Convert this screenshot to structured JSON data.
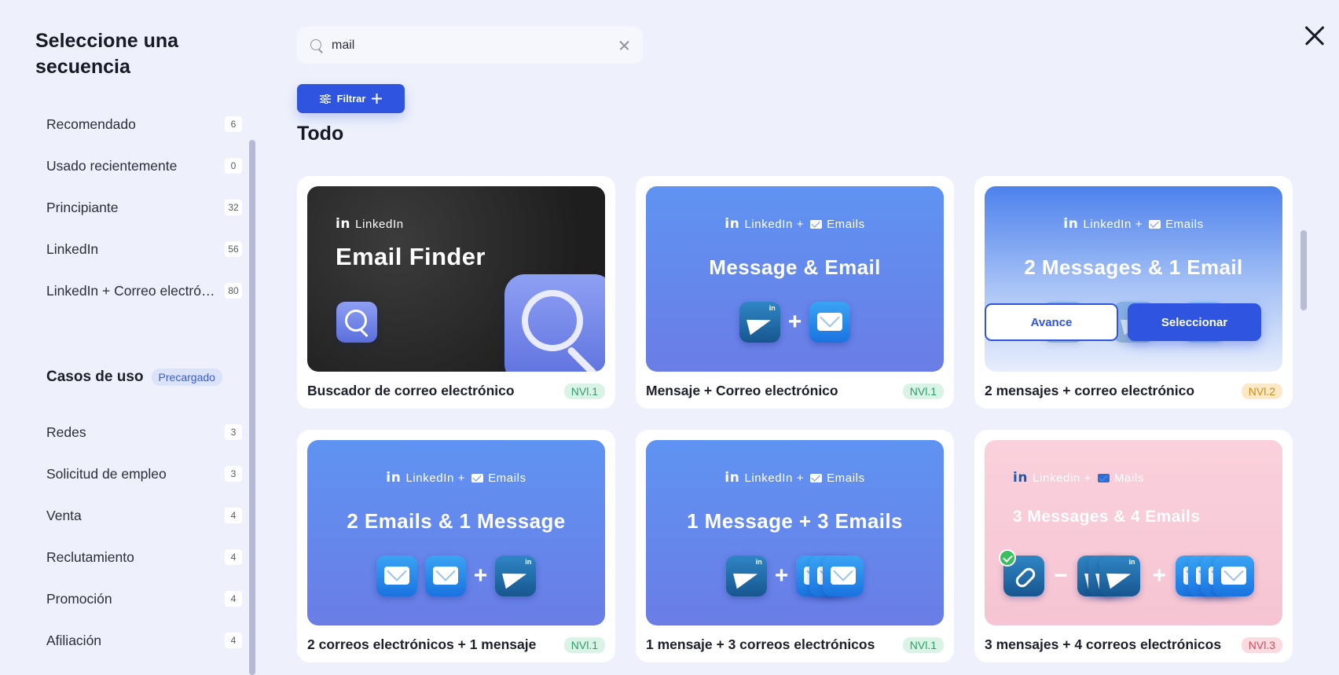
{
  "sidebar": {
    "title": "Seleccione una secuencia",
    "categories": [
      {
        "label": "Recomendado",
        "count": "6"
      },
      {
        "label": "Usado recientemente",
        "count": "0"
      },
      {
        "label": "Principiante",
        "count": "32"
      },
      {
        "label": "LinkedIn",
        "count": "56"
      },
      {
        "label": "LinkedIn + Correo electrónico",
        "count": "80"
      }
    ],
    "use_cases_title": "Casos de uso",
    "use_cases_tag": "Precargado",
    "use_cases": [
      {
        "label": "Redes",
        "count": "3"
      },
      {
        "label": "Solicitud de empleo",
        "count": "3"
      },
      {
        "label": "Venta",
        "count": "4"
      },
      {
        "label": "Reclutamiento",
        "count": "4"
      },
      {
        "label": "Promoción",
        "count": "4"
      },
      {
        "label": "Afiliación",
        "count": "4"
      }
    ]
  },
  "search": {
    "value": "mail"
  },
  "filter_label": "Filtrar",
  "section_title": "Todo",
  "cards": [
    {
      "name": "Buscador de correo electrónico",
      "level": "NVl.1",
      "thumb_top": "LinkedIn",
      "thumb_title": "Email Finder"
    },
    {
      "name": "Mensaje + Correo electrónico",
      "level": "NVl.1",
      "thumb_top_a": "LinkedIn +",
      "thumb_top_b": "Emails",
      "thumb_title": "Message & Email"
    },
    {
      "name": "2 mensajes + correo electrónico",
      "level": "NVl.2",
      "thumb_top_a": "LinkedIn +",
      "thumb_top_b": "Emails",
      "thumb_title": "2 Messages & 1 Email",
      "btn_preview": "Avance",
      "btn_select": "Seleccionar"
    },
    {
      "name": "2 correos electrónicos + 1 mensaje",
      "level": "NVl.1",
      "thumb_top_a": "LinkedIn +",
      "thumb_top_b": "Emails",
      "thumb_title": "2 Emails & 1 Message"
    },
    {
      "name": "1 mensaje + 3 correos electrónicos",
      "level": "NVl.1",
      "thumb_top_a": "LinkedIn +",
      "thumb_top_b": "Emails",
      "thumb_title": "1 Message + 3 Emails"
    },
    {
      "name": "3 mensajes + 4 correos electrónicos",
      "level": "NVl.3",
      "thumb_top_a": "Linkedin +",
      "thumb_top_b": "Mails",
      "thumb_title": "3 Messages & 4 Emails"
    }
  ],
  "icons": {
    "close": "close-icon",
    "search": "search-icon",
    "filter": "sliders-icon"
  },
  "colors": {
    "accent": "#2f54e0",
    "background": "#eef1fb"
  }
}
